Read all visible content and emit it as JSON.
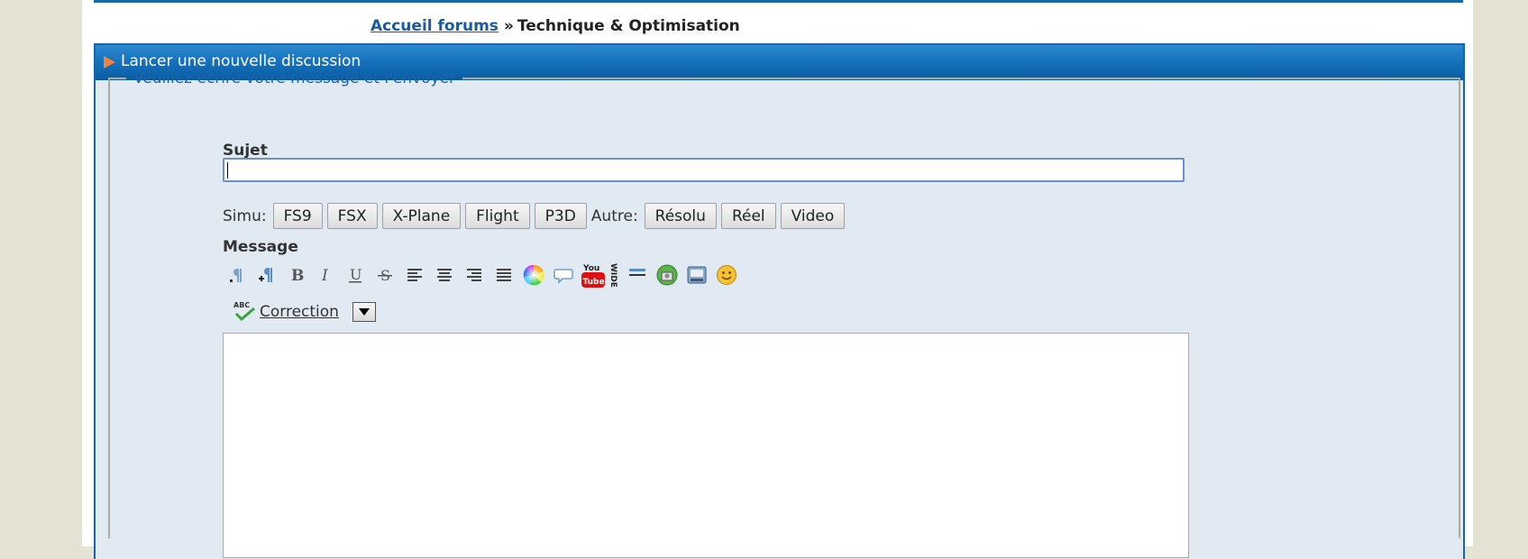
{
  "breadcrumb": {
    "home_link": "Accueil forums",
    "separator": "»",
    "current": "Technique & Optimisation"
  },
  "panel": {
    "title": "Lancer une nouvelle discussion"
  },
  "form": {
    "legend": "Veuillez écrire votre message et l'envoyer",
    "subject_label": "Sujet",
    "subject_value": "",
    "simu_label": "Simu:",
    "simu_buttons": [
      "FS9",
      "FSX",
      "X-Plane",
      "Flight",
      "P3D"
    ],
    "other_label": "Autre:",
    "other_buttons": [
      "Résolu",
      "Réel",
      "Video"
    ],
    "message_label": "Message",
    "toolbar_icons": [
      "paragraph-rtl-icon",
      "paragraph-add-icon",
      "bold-icon",
      "italic-icon",
      "underline-icon",
      "strikethrough-icon",
      "align-left-icon",
      "align-center-icon",
      "align-right-icon",
      "justify-icon",
      "color-wheel-icon",
      "quote-bubble-icon",
      "youtube-icon",
      "wide-icon",
      "horizontal-rule-icon",
      "insert-image-icon",
      "insert-media-icon",
      "smiley-icon"
    ],
    "spellcheck_badge": "ABC",
    "spellcheck_label": "Correction",
    "message_value": ""
  },
  "colors": {
    "page_bg": "#e3e2d3",
    "header_blue": "#1671bd",
    "link_blue": "#1c5aa1",
    "panel_bg": "#e1e9f2",
    "arrow_orange": "#f0843a"
  }
}
